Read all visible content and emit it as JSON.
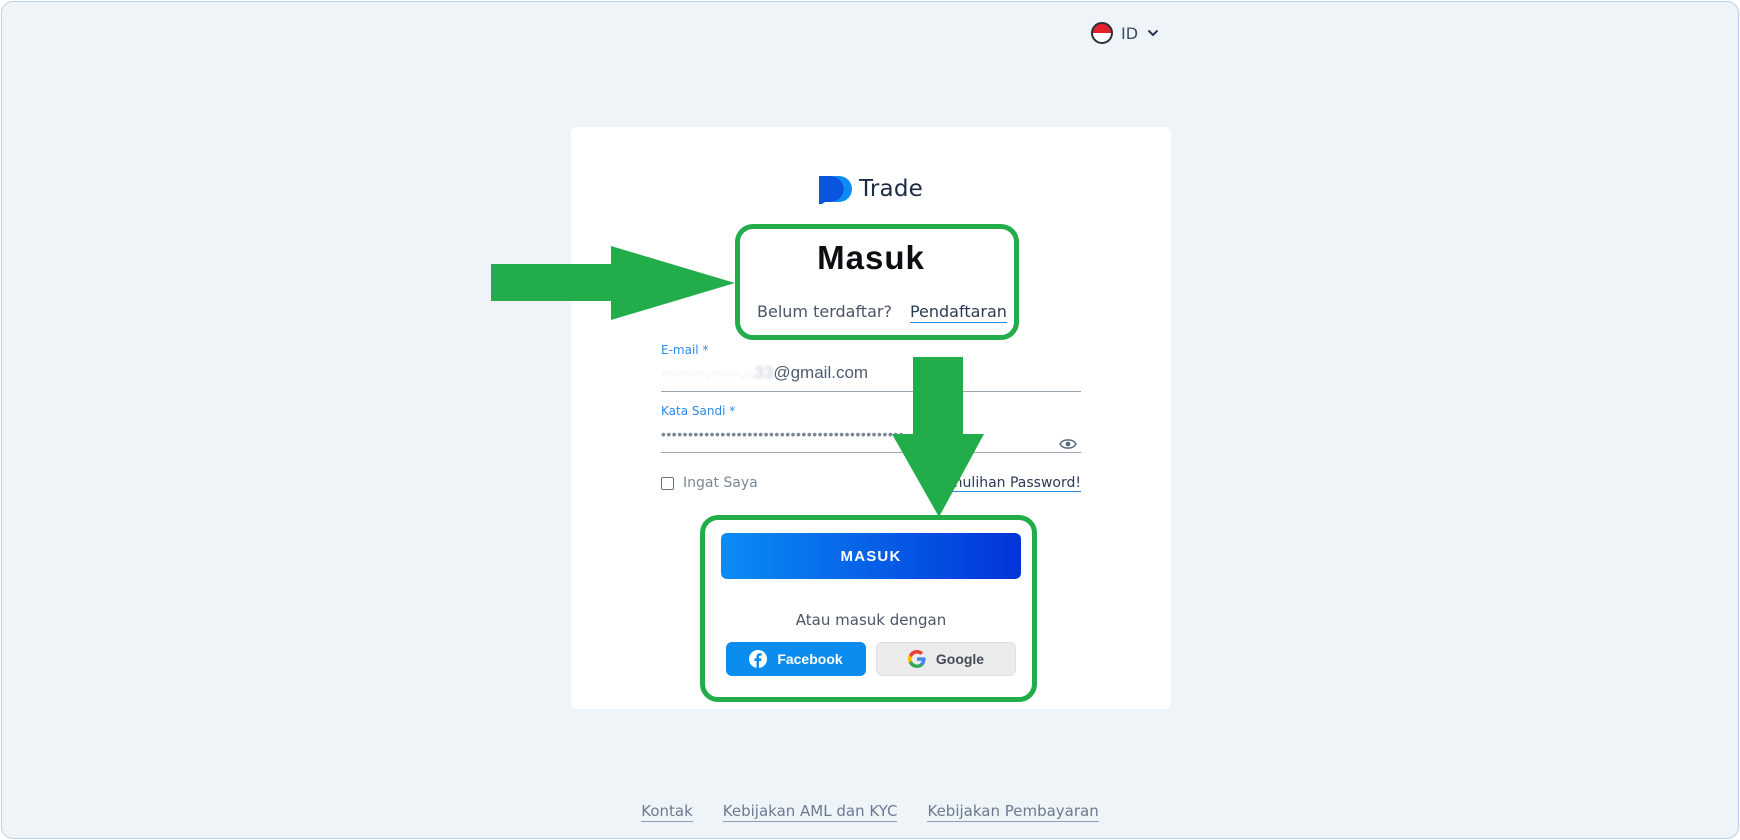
{
  "language": {
    "code": "ID"
  },
  "brand": {
    "name": "Trade",
    "colors": {
      "primary": "#0a8cf4",
      "primary_dark": "#0234d9",
      "annotation": "#22ad4a"
    }
  },
  "login": {
    "title": "Masuk",
    "signup_prompt": "Belum terdaftar?",
    "signup_link": "Pendaftaran",
    "email": {
      "label": "E-mail *",
      "value_masked": "········.·····.·.33",
      "value_domain": "@gmail.com"
    },
    "password": {
      "label": "Kata Sandi *",
      "value": "•••••••••••••••••••••••••••••••••••••••••••••"
    },
    "remember_label": "Ingat Saya",
    "recover_link": "Pemulihan Password!",
    "submit_label": "MASUK",
    "alt_text": "Atau masuk dengan",
    "facebook_label": "Facebook",
    "google_label": "Google"
  },
  "footer": {
    "links": [
      "Kontak",
      "Kebijakan AML dan KYC",
      "Kebijakan Pembayaran"
    ]
  },
  "icons": [
    "flag-indonesia-icon",
    "chevron-down-icon",
    "eye-icon",
    "facebook-icon",
    "google-icon",
    "logo-icon"
  ]
}
